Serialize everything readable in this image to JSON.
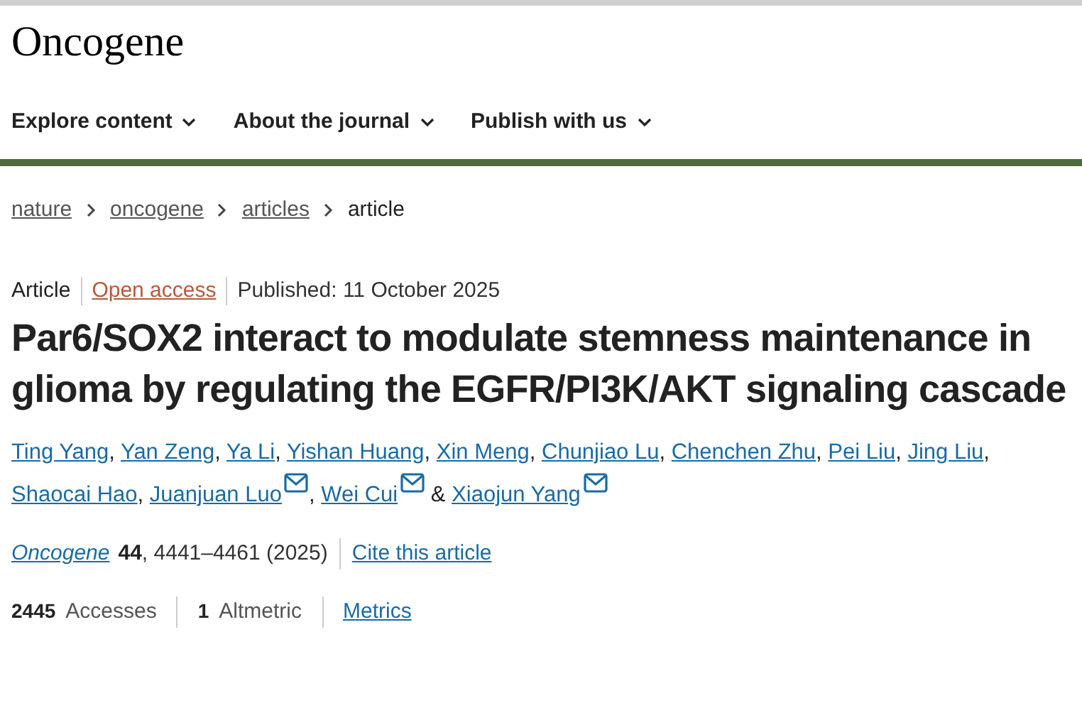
{
  "journal_title": "Oncogene",
  "nav": [
    {
      "label": "Explore content"
    },
    {
      "label": "About the journal"
    },
    {
      "label": "Publish with us"
    }
  ],
  "breadcrumbs": [
    {
      "label": "nature",
      "link": true
    },
    {
      "label": "oncogene",
      "link": true
    },
    {
      "label": "articles",
      "link": true
    },
    {
      "label": "article",
      "link": false
    }
  ],
  "meta": [
    {
      "kind": "type",
      "text": "Article"
    },
    {
      "kind": "access",
      "text": "Open access"
    },
    {
      "kind": "date",
      "text": "Published: 11 October 2025"
    }
  ],
  "title": "Par6/SOX2 interact to modulate stemness maintenance in glioma by regulating the EGFR/PI3K/AKT signaling cascade",
  "authors": [
    {
      "kind": "author",
      "name": "Ting Yang",
      "suffix": ","
    },
    {
      "kind": "author",
      "name": "Yan Zeng",
      "suffix": ","
    },
    {
      "kind": "author",
      "name": "Ya Li",
      "suffix": ","
    },
    {
      "kind": "author",
      "name": "Yishan Huang",
      "suffix": ","
    },
    {
      "kind": "author",
      "name": "Xin Meng",
      "suffix": ","
    },
    {
      "kind": "author",
      "name": "Chunjiao Lu",
      "suffix": ","
    },
    {
      "kind": "author",
      "name": "Chenchen Zhu",
      "suffix": ","
    },
    {
      "kind": "author",
      "name": "Pei Liu",
      "suffix": ","
    },
    {
      "kind": "author",
      "name": "Jing Liu",
      "suffix": ","
    },
    {
      "kind": "author",
      "name": "Shaocai Hao",
      "suffix": ","
    },
    {
      "kind": "corresponding",
      "name": "Juanjuan Luo",
      "suffix": ","
    },
    {
      "kind": "corresponding",
      "name": "Wei Cui",
      "suffix": "&"
    },
    {
      "kind": "corresponding",
      "name": "Xiaojun Yang"
    }
  ],
  "citation": {
    "journal": "Oncogene",
    "volume": "44",
    "pages": ", 4441–4461 (2025)",
    "cite_link": "Cite this article"
  },
  "metrics": [
    {
      "kind": "count",
      "value": "2445",
      "label": "Accesses"
    },
    {
      "kind": "count",
      "value": "1",
      "label": "Altmetric"
    },
    {
      "kind": "link",
      "label": "Metrics"
    }
  ]
}
